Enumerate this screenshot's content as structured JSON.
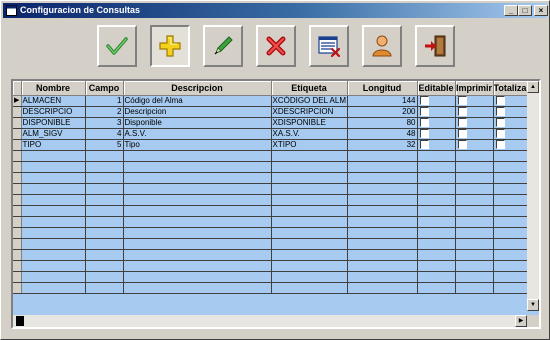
{
  "window": {
    "title": "Configuracion de Consultas",
    "controls": {
      "minimize": "_",
      "maximize": "□",
      "close": "×"
    }
  },
  "toolbar": [
    {
      "name": "accept-button",
      "icon": "check-icon"
    },
    {
      "name": "add-button",
      "icon": "plus-icon"
    },
    {
      "name": "edit-button",
      "icon": "pencil-icon"
    },
    {
      "name": "delete-button",
      "icon": "x-icon"
    },
    {
      "name": "clear-list-button",
      "icon": "list-delete-icon"
    },
    {
      "name": "user-button",
      "icon": "user-icon"
    },
    {
      "name": "exit-button",
      "icon": "exit-door-icon"
    }
  ],
  "grid": {
    "columns": [
      "Nombre",
      "Campo",
      "Descripcion",
      "Etiqueta",
      "Longitud",
      "Editable",
      "Imprimir",
      "Totalizar"
    ],
    "rows": [
      {
        "nombre": "ALMACEN",
        "campo": "1",
        "descripcion": "Código del Alma",
        "etiqueta": "XCÓDIGO DEL ALM",
        "longitud": "144"
      },
      {
        "nombre": "DESCRIPCIO",
        "campo": "2",
        "descripcion": "Descripcion",
        "etiqueta": "XDESCRIPCION",
        "longitud": "200"
      },
      {
        "nombre": "DISPONIBLE",
        "campo": "3",
        "descripcion": "Disponible",
        "etiqueta": "XDISPONIBLE",
        "longitud": "80"
      },
      {
        "nombre": "ALM_SIGV",
        "campo": "4",
        "descripcion": "A.S.V.",
        "etiqueta": "XA.S.V.",
        "longitud": "48"
      },
      {
        "nombre": "TIPO",
        "campo": "5",
        "descripcion": "Tipo",
        "etiqueta": "XTIPO",
        "longitud": "32"
      }
    ],
    "current_row_marker": "▶"
  },
  "colors": {
    "title_gradient_start": "#0a246a",
    "grid_background": "#a6caf0",
    "window_face": "#d4d0c8"
  }
}
